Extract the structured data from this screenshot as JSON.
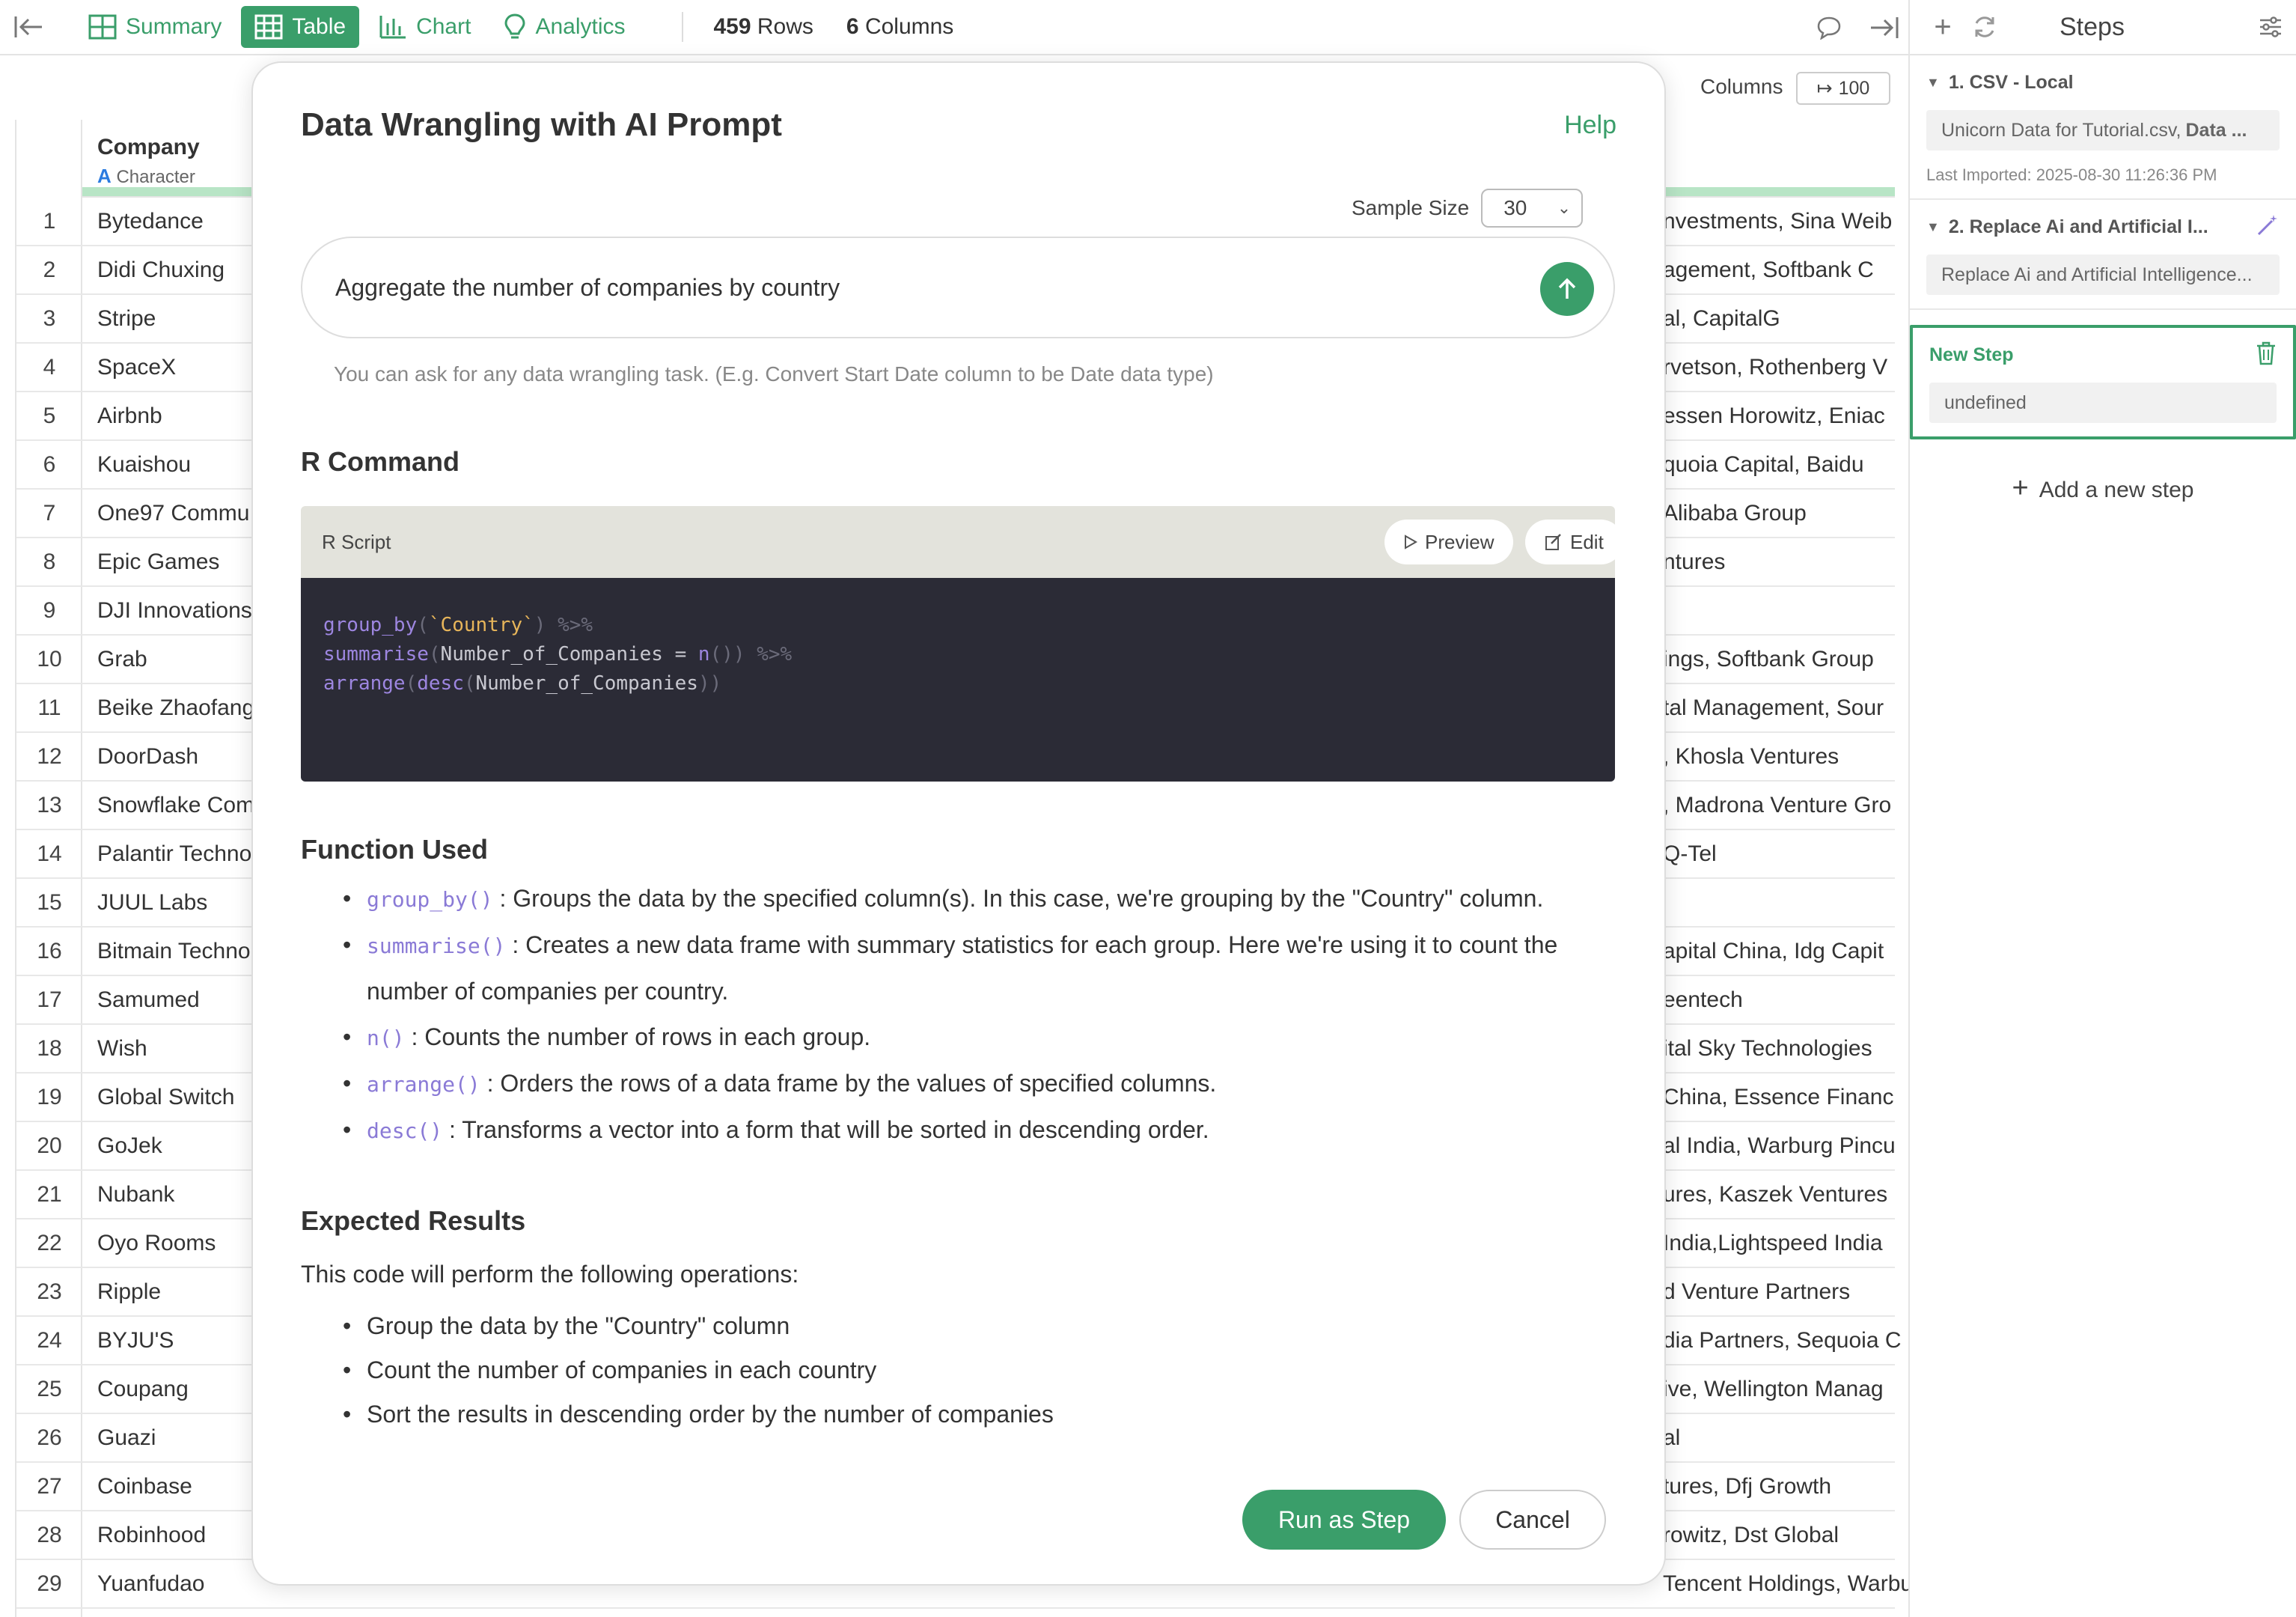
{
  "toolbar": {
    "tabs": [
      {
        "label": "Summary"
      },
      {
        "label": "Table"
      },
      {
        "label": "Chart"
      },
      {
        "label": "Analytics"
      }
    ],
    "rows_count": "459",
    "rows_label": "Rows",
    "cols_count": "6",
    "cols_label": "Columns"
  },
  "table": {
    "header": {
      "name": "Company",
      "type_letter": "A",
      "type": "Character"
    },
    "columns_label": "Columns",
    "columns_button": "100",
    "rows": [
      {
        "n": "1",
        "company": "Bytedance",
        "inv": "nvestments, Sina Weib"
      },
      {
        "n": "2",
        "company": "Didi Chuxing",
        "inv": "agement, Softbank C"
      },
      {
        "n": "3",
        "company": "Stripe",
        "inv": "al, CapitalG"
      },
      {
        "n": "4",
        "company": "SpaceX",
        "inv": "rvetson, Rothenberg V"
      },
      {
        "n": "5",
        "company": "Airbnb",
        "inv": "essen Horowitz, Eniac"
      },
      {
        "n": "6",
        "company": "Kuaishou",
        "inv": "quoia Capital, Baidu"
      },
      {
        "n": "7",
        "company": "One97 Commu",
        "inv": "Alibaba Group"
      },
      {
        "n": "8",
        "company": "Epic Games",
        "inv": "ntures"
      },
      {
        "n": "9",
        "company": "DJI Innovations",
        "inv": ""
      },
      {
        "n": "10",
        "company": "Grab",
        "inv": "ings, Softbank Group"
      },
      {
        "n": "11",
        "company": "Beike Zhaofang",
        "inv": "tal Management, Sour"
      },
      {
        "n": "12",
        "company": "DoorDash",
        "inv": ", Khosla Ventures"
      },
      {
        "n": "13",
        "company": "Snowflake Com",
        "inv": ", Madrona Venture Gro"
      },
      {
        "n": "14",
        "company": "Palantir Techno",
        "inv": "Q-Tel"
      },
      {
        "n": "15",
        "company": "JUUL Labs",
        "inv": ""
      },
      {
        "n": "16",
        "company": "Bitmain Techno",
        "inv": "apital China, Idg Capit"
      },
      {
        "n": "17",
        "company": "Samumed",
        "inv": "eentech"
      },
      {
        "n": "18",
        "company": "Wish",
        "inv": "ital Sky Technologies"
      },
      {
        "n": "19",
        "company": "Global Switch",
        "inv": "China, Essence Financ"
      },
      {
        "n": "20",
        "company": "GoJek",
        "inv": "al India, Warburg Pincu"
      },
      {
        "n": "21",
        "company": "Nubank",
        "inv": "ures, Kaszek Ventures"
      },
      {
        "n": "22",
        "company": "Oyo Rooms",
        "inv": "India,Lightspeed India"
      },
      {
        "n": "23",
        "company": "Ripple",
        "inv": "d Venture Partners"
      },
      {
        "n": "24",
        "company": "BYJU'S",
        "inv": "dia Partners, Sequoia C"
      },
      {
        "n": "25",
        "company": "Coupang",
        "inv": "ive, Wellington Manag"
      },
      {
        "n": "26",
        "company": "Guazi",
        "inv": "al"
      },
      {
        "n": "27",
        "company": "Coinbase",
        "inv": "tures, Dfj Growth"
      },
      {
        "n": "28",
        "company": "Robinhood",
        "inv": "rowitz, Dst Global"
      },
      {
        "n": "29",
        "company": "Yuanfudao",
        "inv": "Tencent Holdings, Warburg Pincus, Idg Capital"
      }
    ]
  },
  "side": {
    "title": "Steps",
    "steps": [
      {
        "name": "1. CSV - Local",
        "desc_prefix": "Unicorn Data for Tutorial.csv, ",
        "desc_bold": "Data ...",
        "meta": "Last Imported: 2025-08-30 11:26:36 PM"
      },
      {
        "name": "2. Replace Ai and Artificial I...",
        "desc": "Replace Ai and Artificial Intelligence..."
      }
    ],
    "new_step": {
      "name": "New Step",
      "value": "undefined"
    },
    "add_step": "Add a new step"
  },
  "modal": {
    "title": "Data Wrangling with AI Prompt",
    "help": "Help",
    "sample_label": "Sample Size",
    "sample_value": "30",
    "prompt": "Aggregate the number of companies by country",
    "hint": "You can ask for any data wrangling task. (E.g. Convert Start Date column to be Date data type)",
    "r_command_title": "R Command",
    "script_label": "R Script",
    "preview": "Preview",
    "edit": "Edit",
    "function_title": "Function Used",
    "functions": [
      {
        "code": "group_by()",
        "text": ": Groups the data by the specified column(s). In this case, we're grouping by the \"Country\" column."
      },
      {
        "code": "summarise()",
        "text": ": Creates a new data frame with summary statistics for each group. Here we're using it to count the number of companies per country."
      },
      {
        "code": "n()",
        "text": ": Counts the number of rows in each group."
      },
      {
        "code": "arrange()",
        "text": ": Orders the rows of a data frame by the values of specified columns."
      },
      {
        "code": "desc()",
        "text": ": Transforms a vector into a form that will be sorted in descending order."
      }
    ],
    "expected_title": "Expected Results",
    "expected_intro": "This code will perform the following operations:",
    "expected": [
      "Group the data by the \"Country\" column",
      "Count the number of companies in each country",
      "Sort the results in descending order by the number of companies"
    ],
    "run": "Run as Step",
    "cancel": "Cancel"
  }
}
